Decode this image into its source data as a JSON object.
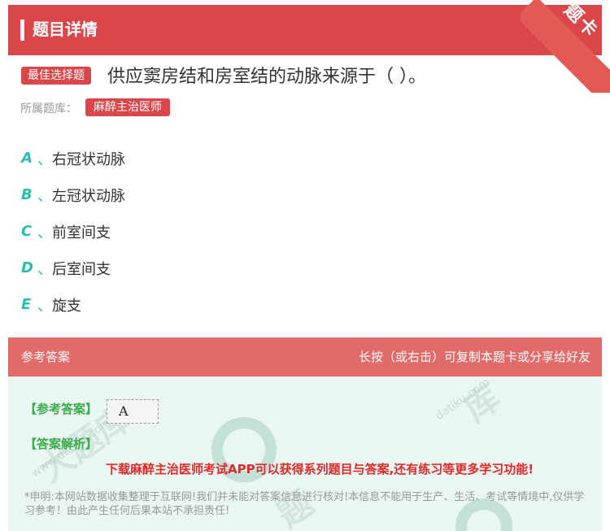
{
  "header": {
    "title": "题目详情"
  },
  "ribbon": {
    "text": "题卡"
  },
  "question": {
    "type_tag": "最佳选择题",
    "text": "供应窦房结和房室结的动脉来源于（ ）。"
  },
  "bank": {
    "label": "所属题库：",
    "name": "麻醉主治医师"
  },
  "options": [
    {
      "letter": "A",
      "sep": "、",
      "text": "右冠状动脉"
    },
    {
      "letter": "B",
      "sep": "、",
      "text": "左冠状动脉"
    },
    {
      "letter": "C",
      "sep": "、",
      "text": "前室间支"
    },
    {
      "letter": "D",
      "sep": "、",
      "text": "后室间支"
    },
    {
      "letter": "E",
      "sep": "、",
      "text": "旋支"
    }
  ],
  "answer_bar": {
    "left": "参考答案",
    "right": "长按（或右击）可复制本题卡或分享给好友"
  },
  "answer": {
    "ref_label": "【参考答案】",
    "ref_value": "A",
    "exp_label": "【答案解析】",
    "promo": "下载麻醉主治医师考试APP可以获得系列题目与答案,还有练习等更多学习功能!",
    "disclaimer": "*申明:本网站数据收集整理于互联网!我们并未能对答案信息进行核对!本信息不能用于生产、生活、考试等情境中,仅供学习参考！由此产生任何后果本站不承担责任!"
  },
  "colors": {
    "header": "#d9474b",
    "accent": "#2bbcad",
    "answer_bg": "#e9f6f2",
    "promo": "#e02a2a"
  }
}
